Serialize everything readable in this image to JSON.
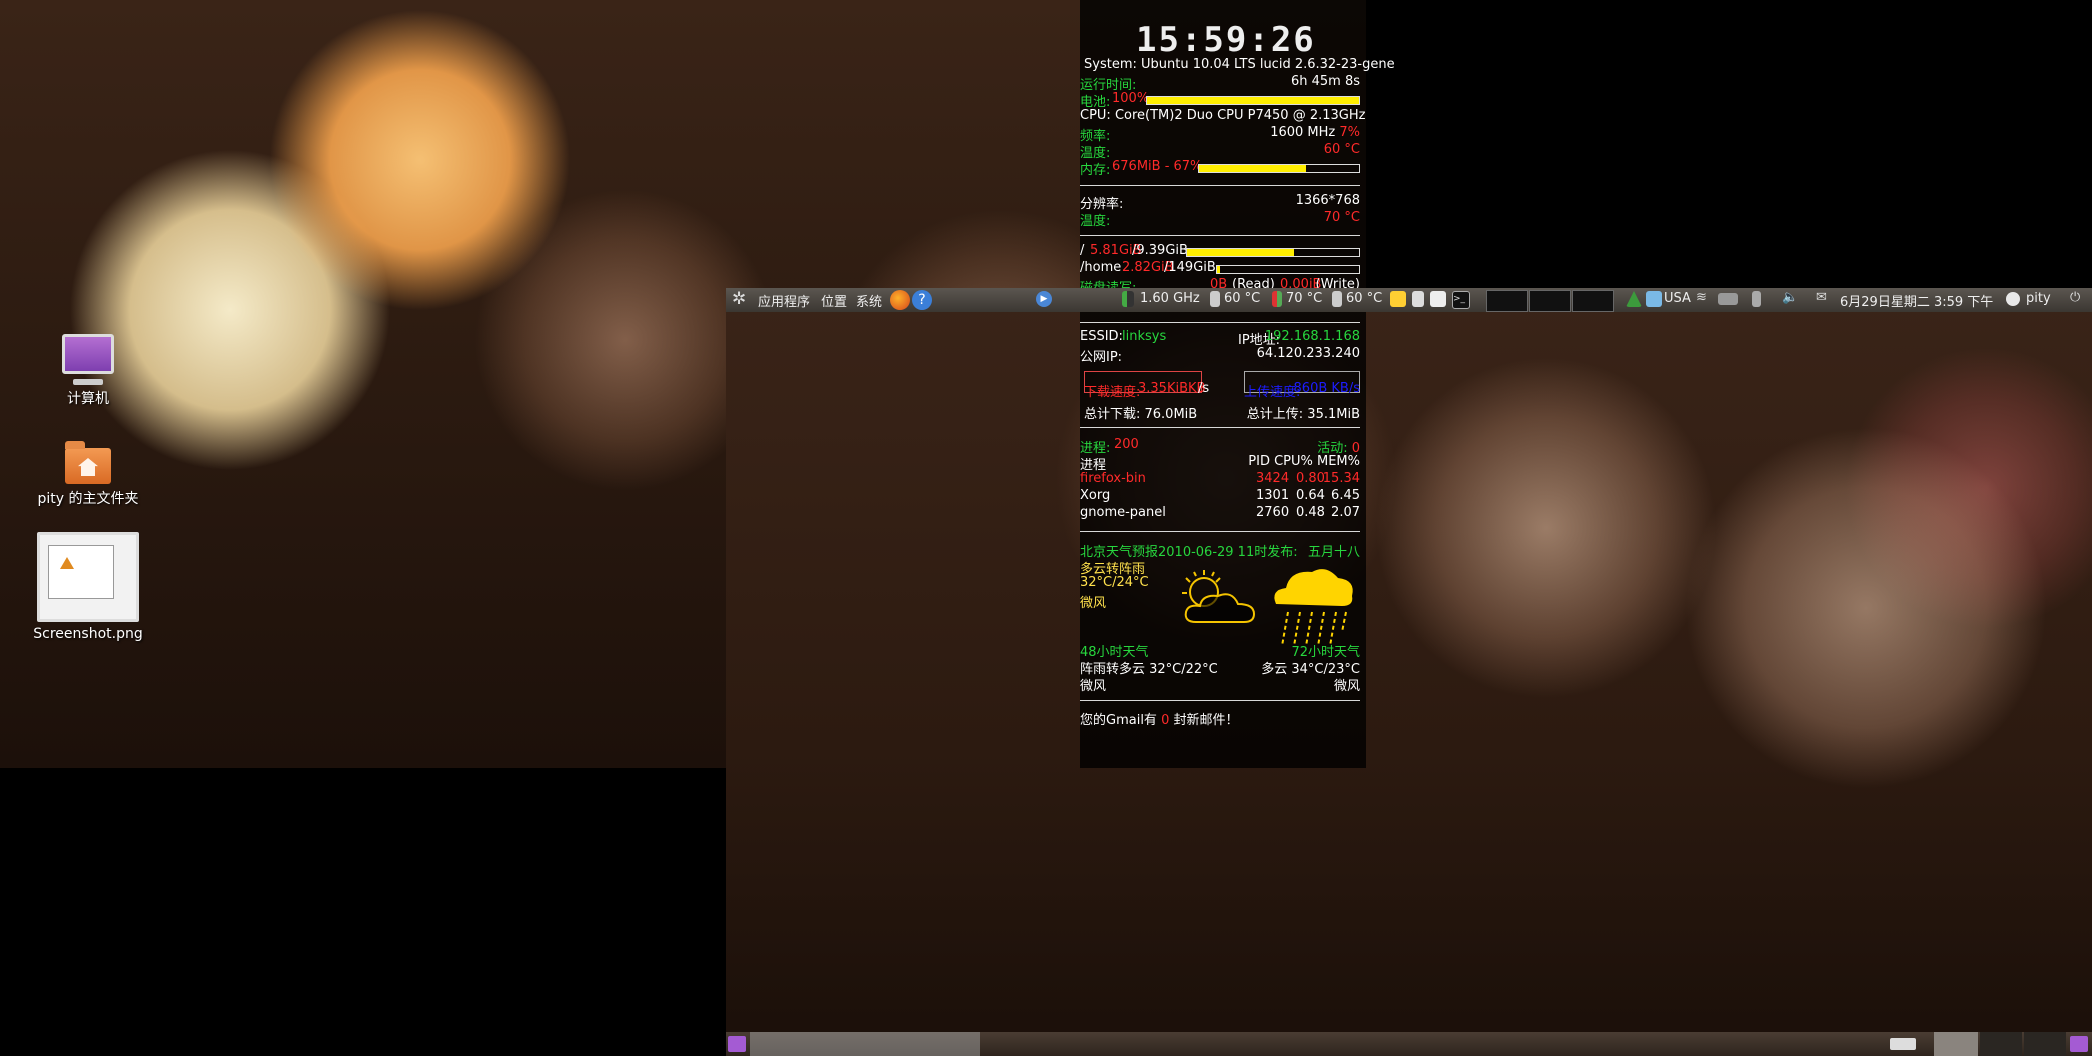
{
  "desktop": {
    "icons": [
      {
        "label": "计算机"
      },
      {
        "label": "pity 的主文件夹"
      },
      {
        "label": "Screenshot.png"
      }
    ]
  },
  "conky": {
    "clock": "15:59:26",
    "system": "System: Ubuntu 10.04 LTS lucid  2.6.32-23-gene",
    "uptime_label": "运行时间:",
    "uptime": "6h 45m 8s",
    "battery_label": "电池:",
    "battery_value": "100%",
    "battery_level": 100,
    "cpu": "CPU: Core(TM)2 Duo CPU     P7450  @ 2.13GHz",
    "freq_label": "频率:",
    "freq_value": "1600 MHz",
    "freq_pct": "7%",
    "cpu_temp_label": "温度:",
    "cpu_temp": "60 °C",
    "mem_label": "内存:",
    "mem_value": "676MiB - 67%",
    "mem_level": 67,
    "res_label": "分辨率:",
    "res_value": "1366*768",
    "gpu_temp_label": "温度:",
    "gpu_temp": "70 °C",
    "root_label": "/",
    "root_used": "5.81GiB",
    "root_total": "/9.39GiB",
    "root_level": 62,
    "home_label": "/home",
    "home_used": "2.82GiB",
    "home_total": "/149GiB",
    "home_level": 2,
    "disk_label": "磁盘读写:",
    "disk_read": "0B",
    "disk_read_unit": "(Read)",
    "disk_write": "0.00iB",
    "disk_write_unit": "(Write)",
    "essid_label": "ESSID:",
    "essid_value": "linksys",
    "ip_label": "IP地址:",
    "ip_value": "192.168.1.168",
    "public_ip_label": "公网IP:",
    "public_ip_value": "64.120.233.240",
    "down_label": "下载速度:",
    "down_value": "3.35KiBKB",
    "down_unit": "/s",
    "up_label": "上传速度:",
    "up_value": "860B  KB/s",
    "total_down": "总计下载: 76.0MiB",
    "total_up": "总计上传: 35.1MiB",
    "proc_label": "进程:",
    "proc_value": "200",
    "active_label": "活动:",
    "active_value": "0",
    "proc_header_name": "进程",
    "proc_header_cols": "PID CPU% MEM%",
    "processes": [
      {
        "name": "firefox-bin",
        "pid": "3424",
        "cpu": "0.80",
        "mem": "15.34"
      },
      {
        "name": "Xorg",
        "pid": "1301",
        "cpu": "0.64",
        "mem": "6.45"
      },
      {
        "name": "gnome-panel",
        "pid": "2760",
        "cpu": "0.48",
        "mem": "2.07"
      }
    ],
    "weather_title": "北京天气预报2010-06-29 11时发布:",
    "lunar": "五月十八",
    "today_cond": "多云转阵雨",
    "today_temp": "32°C/24°C",
    "today_wind": "微风",
    "w48_label": "48小时天气",
    "w48_cond": "阵雨转多云 32°C/22°C",
    "w48_wind": "微风",
    "w72_label": "72小时天气",
    "w72_cond": "多云 34°C/23°C",
    "w72_wind": "微风",
    "gmail_prefix": "您的Gmail有",
    "gmail_count": "0",
    "gmail_suffix": "封新邮件！"
  },
  "top_panel": {
    "menu_apps": "应用程序",
    "menu_places": "位置",
    "menu_system": "系统",
    "cpu_freq": "1.60 GHz",
    "temp1": "60 °C",
    "temp2": "70 °C",
    "temp3": "60 °C",
    "keyboard_layout": "USA",
    "datetime": "6月29日星期二  3:59 下午",
    "user": "pity"
  },
  "colors": {
    "green": "#27d63e",
    "red": "#ff2a2a",
    "bar": "#ffee00"
  }
}
